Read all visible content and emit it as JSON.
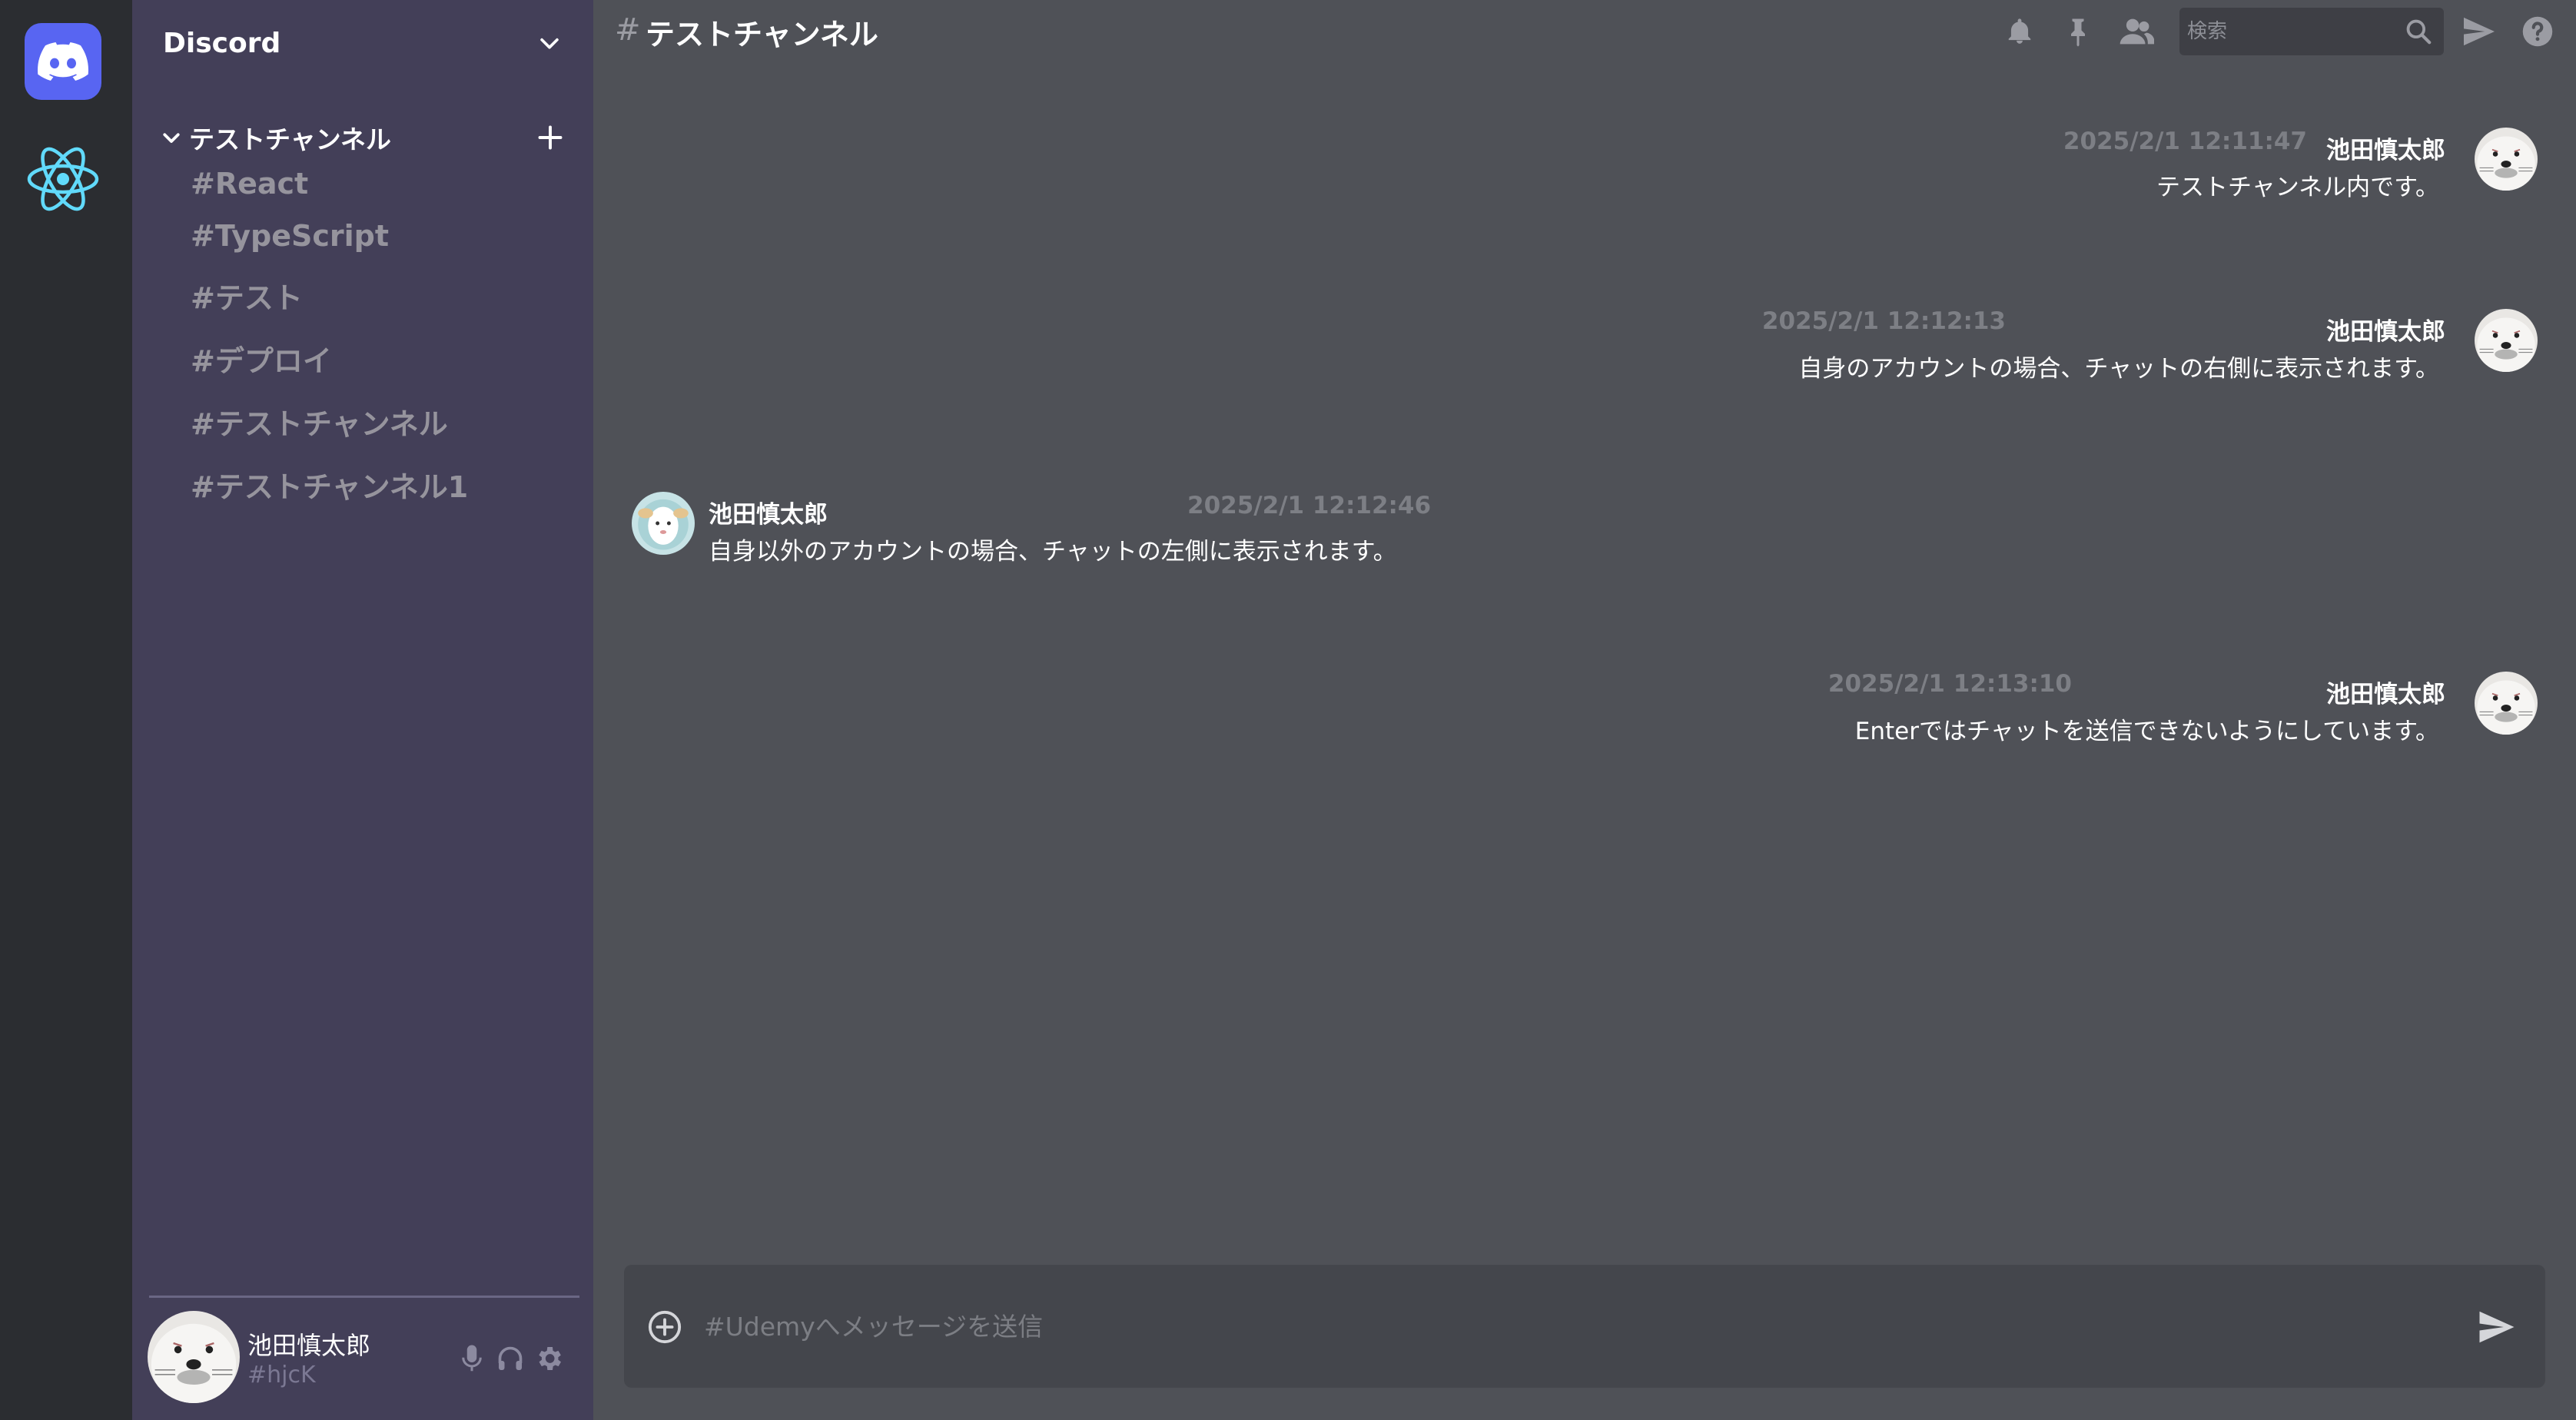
{
  "app": {
    "server_name": "Discord"
  },
  "servers": [
    {
      "name": "discord-icon"
    },
    {
      "name": "react-icon"
    }
  ],
  "sidebar": {
    "category": "テストチャンネル",
    "channels": [
      "#React",
      "#TypeScript",
      "#テスト",
      "#デプロイ",
      "#テストチャンネル",
      "#テストチャンネル1"
    ]
  },
  "user": {
    "name": "池田慎太郎",
    "tag": "#hjcK"
  },
  "topbar": {
    "hash": "#",
    "channel_title": "テストチャンネル",
    "search_placeholder": "検索"
  },
  "messages": [
    {
      "side": "right",
      "author": "池田慎太郎",
      "time": "2025/2/1 12:11:47",
      "text": "テストチャンネル内です。"
    },
    {
      "side": "right",
      "author": "池田慎太郎",
      "time": "2025/2/1 12:12:13",
      "text": "自身のアカウントの場合、チャットの右側に表示されます。"
    },
    {
      "side": "left",
      "author": "池田慎太郎",
      "time": "2025/2/1 12:12:46",
      "text": "自身以外のアカウントの場合、チャットの左側に表示されます。"
    },
    {
      "side": "right",
      "author": "池田慎太郎",
      "time": "2025/2/1 12:13:10",
      "text": "Enterではチャットを送信できないようにしています。"
    }
  ],
  "composer": {
    "placeholder": "#Udemyへメッセージを送信"
  },
  "colors": {
    "rail_bg": "#2b2d31",
    "sidebar_bg": "#433f58",
    "main_bg": "#4f5157",
    "accent": "#5865f2",
    "react": "#61dafb"
  }
}
